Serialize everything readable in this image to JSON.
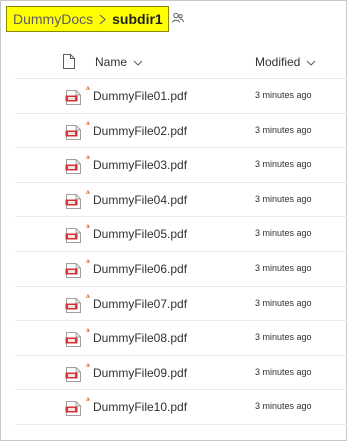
{
  "breadcrumb": {
    "root": "DummyDocs",
    "current": "subdir1"
  },
  "columns": {
    "name": "Name",
    "modified": "Modified"
  },
  "files": [
    {
      "name": "DummyFile01.pdf",
      "modified": "3 minutes ago"
    },
    {
      "name": "DummyFile02.pdf",
      "modified": "3 minutes ago"
    },
    {
      "name": "DummyFile03.pdf",
      "modified": "3 minutes ago"
    },
    {
      "name": "DummyFile04.pdf",
      "modified": "3 minutes ago"
    },
    {
      "name": "DummyFile05.pdf",
      "modified": "3 minutes ago"
    },
    {
      "name": "DummyFile06.pdf",
      "modified": "3 minutes ago"
    },
    {
      "name": "DummyFile07.pdf",
      "modified": "3 minutes ago"
    },
    {
      "name": "DummyFile08.pdf",
      "modified": "3 minutes ago"
    },
    {
      "name": "DummyFile09.pdf",
      "modified": "3 minutes ago"
    },
    {
      "name": "DummyFile10.pdf",
      "modified": "3 minutes ago"
    }
  ],
  "icons": {
    "separator": "chevron-right-icon",
    "share": "people-icon",
    "file_type_header": "document-icon",
    "sort": "chevron-down-icon",
    "file": "pdf-icon",
    "new_item": "new-item-sparkle-icon"
  },
  "colors": {
    "highlight": "#ffff00",
    "pdf_red": "#d13438",
    "new_sparkle": "#e07a3a"
  }
}
